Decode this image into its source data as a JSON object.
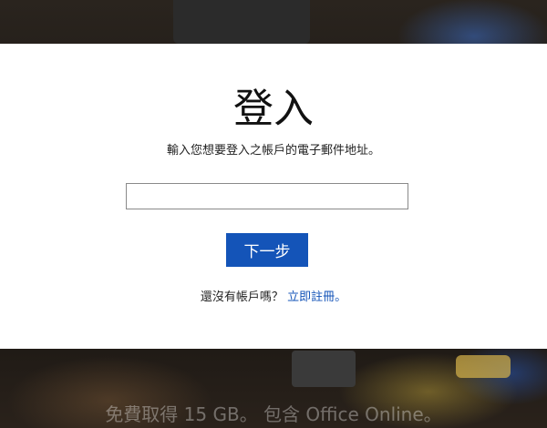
{
  "login": {
    "title": "登入",
    "subtitle": "輸入您想要登入之帳戶的電子郵件地址。",
    "email_placeholder": "",
    "email_value": "",
    "next_label": "下一步",
    "no_account_text": "還沒有帳戶嗎？",
    "signup_link": "立即註冊。"
  },
  "promo": {
    "text": "免費取得 15 GB。 包含 Office Online。"
  },
  "colors": {
    "accent": "#1454b8",
    "card": "#ffffff"
  }
}
